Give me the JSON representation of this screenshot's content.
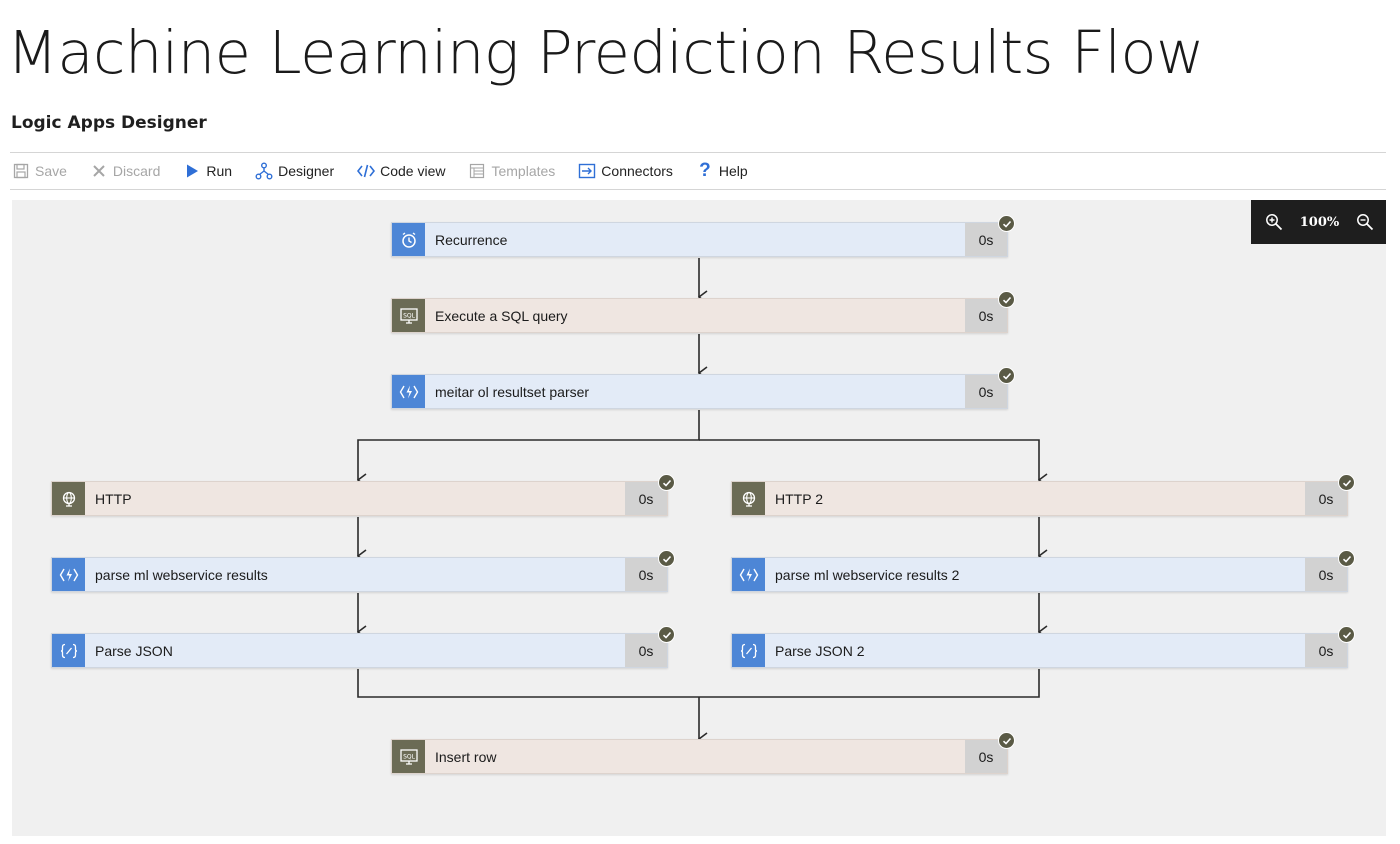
{
  "page": {
    "title": "Machine Learning Prediction Results Flow",
    "subtitle": "Logic Apps Designer"
  },
  "toolbar": {
    "save": {
      "label": "Save",
      "icon": "save-icon",
      "enabled": false
    },
    "discard": {
      "label": "Discard",
      "icon": "discard-icon",
      "enabled": false
    },
    "run": {
      "label": "Run",
      "icon": "run-icon",
      "enabled": true
    },
    "designer": {
      "label": "Designer",
      "icon": "designer-icon",
      "enabled": true
    },
    "code_view": {
      "label": "Code view",
      "icon": "code-view-icon",
      "enabled": true
    },
    "templates": {
      "label": "Templates",
      "icon": "templates-icon",
      "enabled": false
    },
    "connectors": {
      "label": "Connectors",
      "icon": "connectors-icon",
      "enabled": true
    },
    "help": {
      "label": "Help",
      "icon": "help-icon",
      "enabled": true
    }
  },
  "zoom": {
    "level": "100%"
  },
  "steps": {
    "recurrence": {
      "label": "Recurrence",
      "duration": "0s",
      "icon": "clock-icon",
      "status": "succeeded"
    },
    "sql_query": {
      "label": "Execute a SQL query",
      "duration": "0s",
      "icon": "sql-icon",
      "status": "succeeded"
    },
    "resultset_parser": {
      "label": "meitar ol resultset parser",
      "duration": "0s",
      "icon": "function-icon",
      "status": "succeeded"
    },
    "http": {
      "label": "HTTP",
      "duration": "0s",
      "icon": "globe-icon",
      "status": "succeeded"
    },
    "parse_ml": {
      "label": "parse ml webservice results",
      "duration": "0s",
      "icon": "function-icon",
      "status": "succeeded"
    },
    "parse_json": {
      "label": "Parse JSON",
      "duration": "0s",
      "icon": "json-icon",
      "status": "succeeded"
    },
    "http2": {
      "label": "HTTP 2",
      "duration": "0s",
      "icon": "globe-icon",
      "status": "succeeded"
    },
    "parse_ml2": {
      "label": "parse ml webservice results 2",
      "duration": "0s",
      "icon": "function-icon",
      "status": "succeeded"
    },
    "parse_json2": {
      "label": "Parse JSON 2",
      "duration": "0s",
      "icon": "json-icon",
      "status": "succeeded"
    },
    "insert_row": {
      "label": "Insert row",
      "duration": "0s",
      "icon": "sql-icon",
      "status": "succeeded"
    }
  },
  "colors": {
    "action_blue": "#4d86d6",
    "connector_olive": "#6b6b55",
    "card_blue": "#e3ebf7",
    "card_tan": "#efe6e1",
    "success_badge": "#5a5a45"
  }
}
